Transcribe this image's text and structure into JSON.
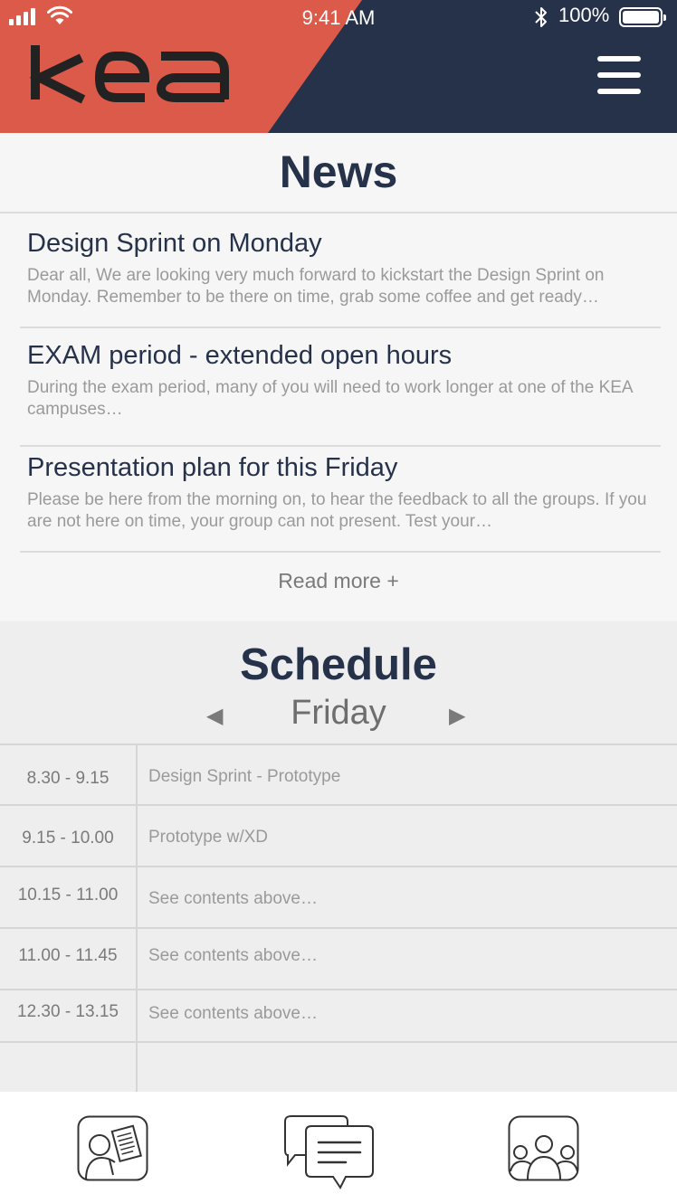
{
  "status_bar": {
    "time": "9:41 AM",
    "battery": "100%"
  },
  "header": {
    "logo_text": "KEA",
    "colors": {
      "red": "#dc5a4a",
      "navy": "#26324a"
    }
  },
  "news": {
    "title": "News",
    "items": [
      {
        "title": "Design Sprint on Monday",
        "excerpt": "Dear all, We are looking very much forward to kickstart the Design Sprint on Monday. Remember to be there on time, grab some coffee and get ready…"
      },
      {
        "title": "EXAM period - extended open hours",
        "excerpt": "During the exam period, many of you will need to work longer at one of the KEA campuses…"
      },
      {
        "title": "Presentation plan for this Friday",
        "excerpt": "Please be here from the morning on, to hear the feedback to all the groups. If you are not here on time, your group can not present. Test your…"
      }
    ],
    "read_more": "Read more +"
  },
  "schedule": {
    "title": "Schedule",
    "day": "Friday",
    "prev_icon": "◀",
    "next_icon": "▶",
    "rows": [
      {
        "time": "8.30 - 9.15",
        "content": "Design Sprint - Prototype"
      },
      {
        "time": "9.15 - 10.00",
        "content": "Prototype w/XD"
      },
      {
        "time": "10.15 - 11.00",
        "content": "See contents above…"
      },
      {
        "time": "11.00 - 11.45",
        "content": "See contents above…"
      },
      {
        "time": "12.30 - 13.15",
        "content": "See contents above…"
      },
      {
        "time": "",
        "content": ""
      }
    ]
  },
  "tabbar": {
    "tabs": [
      {
        "icon": "teacher-icon"
      },
      {
        "icon": "chat-icon"
      },
      {
        "icon": "group-icon"
      }
    ]
  }
}
